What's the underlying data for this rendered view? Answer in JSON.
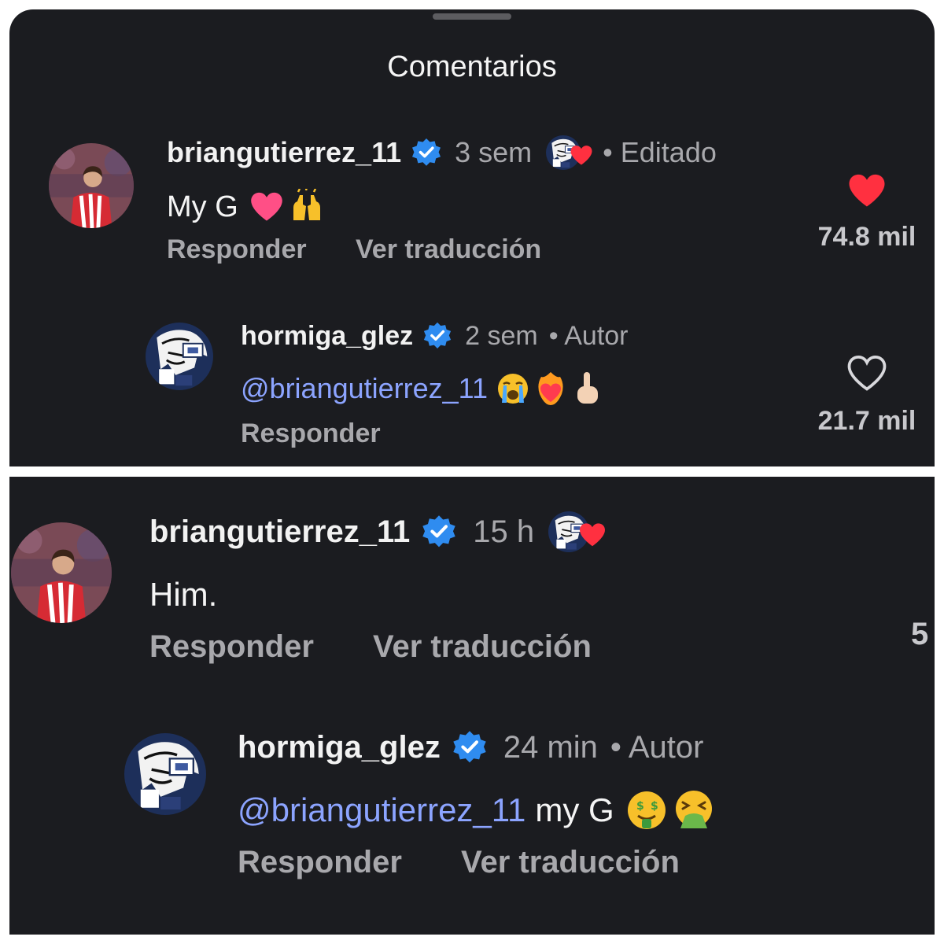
{
  "sheet": {
    "title": "Comentarios"
  },
  "top": {
    "comment": {
      "username": "briangutierrez_11",
      "time": "3 sem",
      "edited": "• Editado",
      "text": "My G",
      "reply_label": "Responder",
      "translate_label": "Ver traducción",
      "likes": "74.8 mil",
      "liked": true
    },
    "reply": {
      "username": "hormiga_glez",
      "time": "2 sem",
      "author": "• Autor",
      "mention": "@briangutierrez_11",
      "reply_label": "Responder",
      "likes": "21.7 mil",
      "liked": false
    }
  },
  "bottom": {
    "comment": {
      "username": "briangutierrez_11",
      "time": "15 h",
      "text": "Him.",
      "reply_label": "Responder",
      "translate_label": "Ver traducción",
      "likes_partial": "5"
    },
    "reply": {
      "username": "hormiga_glez",
      "time": "24 min",
      "author": "• Autor",
      "mention": "@briangutierrez_11",
      "text": "my G",
      "reply_label": "Responder",
      "translate_label": "Ver traducción"
    }
  },
  "colors": {
    "background": "#1b1c20",
    "verified": "#2f8cf0",
    "heart": "#ff3040",
    "mention": "#8ca4ff",
    "meta": "#a8a8ac"
  },
  "icons": [
    "verified-badge-icon",
    "heart-filled-icon",
    "heart-outline-icon",
    "creator-liked-icon"
  ]
}
